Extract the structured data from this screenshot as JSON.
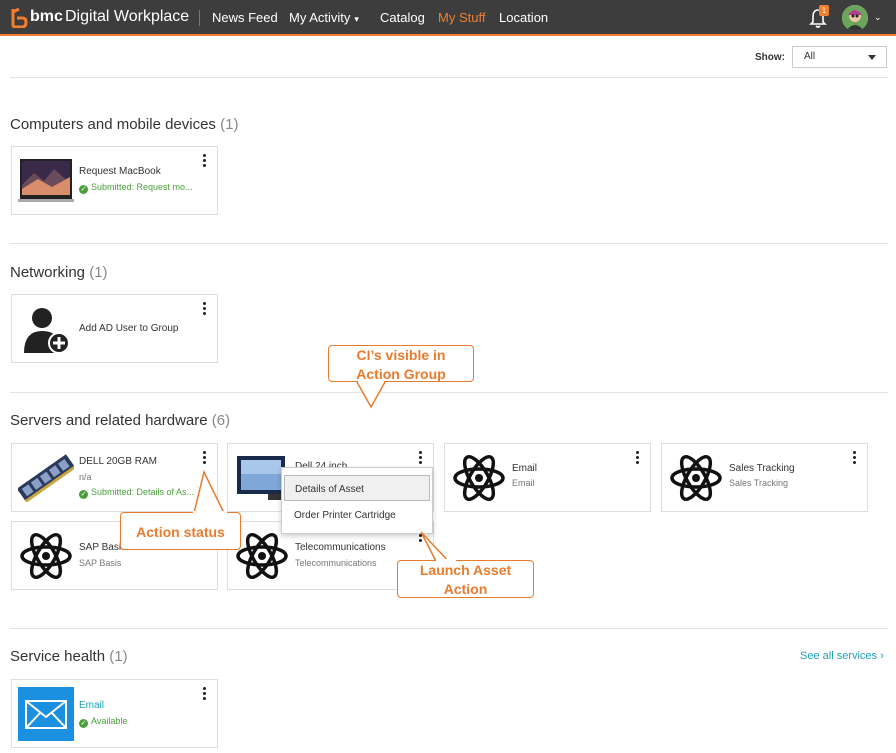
{
  "header": {
    "brand": "bmc",
    "app_name": "Digital Workplace",
    "nav": [
      {
        "label": "News Feed",
        "active": false
      },
      {
        "label": "My Activity",
        "active": false,
        "has_dropdown": true
      },
      {
        "label": "Catalog",
        "active": false
      },
      {
        "label": "My Stuff",
        "active": true
      },
      {
        "label": "Location",
        "active": false
      }
    ],
    "notifications_count": "1",
    "icons": {
      "logo": "bmc-logo-icon",
      "bell": "bell-icon",
      "avatar": "user-avatar",
      "chevron": "chevron-down-icon"
    },
    "colors": {
      "bar": "#3d3d3d",
      "accent": "#f27e2e"
    }
  },
  "filter": {
    "label": "Show:",
    "value": "All"
  },
  "sections": [
    {
      "title": "Computers and mobile devices",
      "count": "(1)",
      "cards": [
        {
          "title": "Request MacBook",
          "status": "Submitted: Request mo...",
          "thumb": "macbook-image"
        }
      ]
    },
    {
      "title": "Networking",
      "count": "(1)",
      "cards": [
        {
          "title": "Add AD User to Group",
          "thumb": "add-user-icon"
        }
      ]
    },
    {
      "title": "Servers and related hardware",
      "count": "(6)",
      "cards": [
        {
          "title": "DELL 20GB RAM",
          "sub": "n/a",
          "status": "Submitted: Details of As...",
          "thumb": "ram-module-image"
        },
        {
          "title": "Dell 24 inch",
          "thumb": "monitor-image"
        },
        {
          "title": "Email",
          "sub": "Email",
          "thumb": "atom-icon"
        },
        {
          "title": "Sales Tracking",
          "sub": "Sales Tracking",
          "thumb": "atom-icon"
        },
        {
          "title": "SAP Basis",
          "sub": "SAP Basis",
          "thumb": "atom-icon"
        },
        {
          "title": "Telecommunications",
          "sub": "Telecommunications",
          "thumb": "atom-icon"
        }
      ]
    },
    {
      "title": "Service health",
      "count": "(1)",
      "link": "See all services",
      "cards": [
        {
          "title": "Email",
          "status": "Available",
          "thumb": "email-envelope-icon"
        }
      ]
    }
  ],
  "menu": {
    "items": [
      "Details of Asset",
      "Order Printer Cartridge"
    ],
    "selected": 0
  },
  "callouts": {
    "ci_visible": "CI’s visible in Action Group",
    "action_status": "Action status",
    "launch_asset": "Launch Asset Action"
  },
  "colors": {
    "callout": "#e87b2c",
    "link": "#20a0b8",
    "ok": "#4a9f3a"
  }
}
